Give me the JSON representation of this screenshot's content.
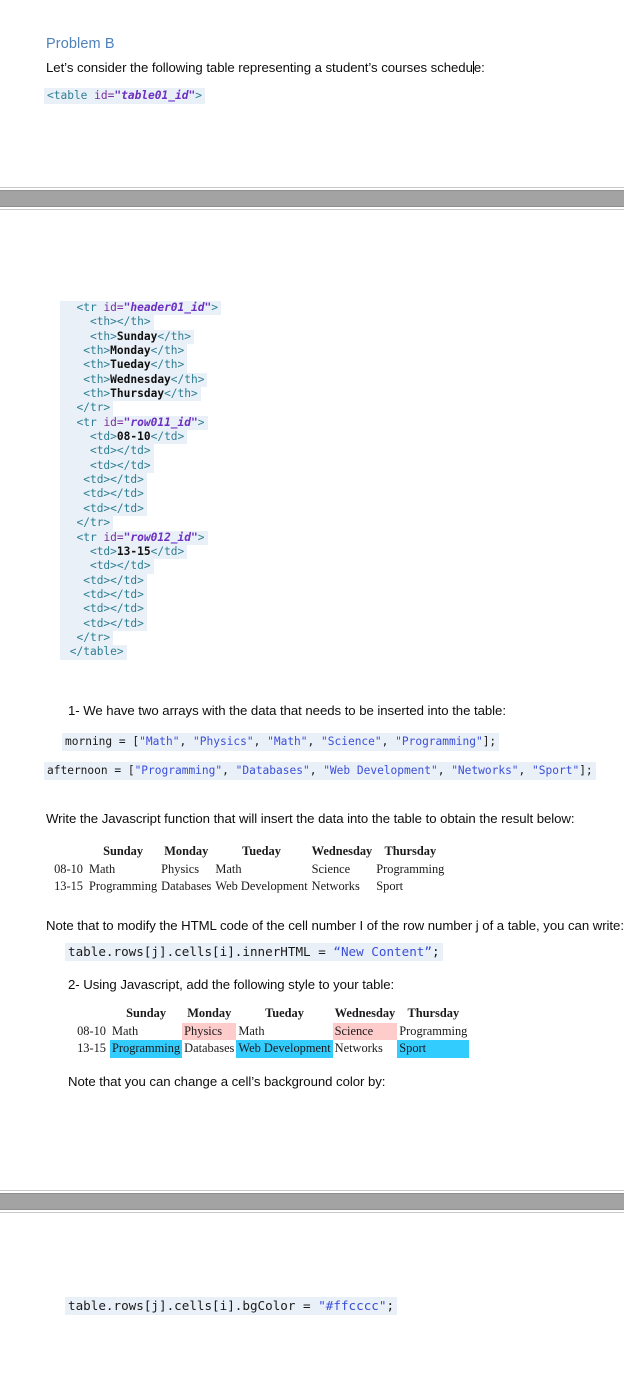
{
  "document": {
    "heading": "Problem B",
    "intro": "Let’s consider the following table representing a student’s courses schedule:",
    "code_open_table": {
      "tag_open": "<table ",
      "attr": "id=",
      "value": "\"table01_id\"",
      "tag_close": ">"
    },
    "code_block": {
      "lines": [
        {
          "indent": "  ",
          "parts": [
            {
              "t": "tag",
              "s": "<tr "
            },
            {
              "t": "attr",
              "s": "id="
            },
            {
              "t": "val",
              "s": "\"header01_id\""
            },
            {
              "t": "tag",
              "s": ">"
            }
          ]
        },
        {
          "indent": "    ",
          "parts": [
            {
              "t": "tag",
              "s": "<th></th>"
            }
          ]
        },
        {
          "indent": "    ",
          "parts": [
            {
              "t": "tag",
              "s": "<th>"
            },
            {
              "t": "txt",
              "s": "Sunday"
            },
            {
              "t": "tag",
              "s": "</th>"
            }
          ]
        },
        {
          "indent": "   ",
          "parts": [
            {
              "t": "tag",
              "s": "<th>"
            },
            {
              "t": "txt",
              "s": "Monday"
            },
            {
              "t": "tag",
              "s": "</th>"
            }
          ]
        },
        {
          "indent": "   ",
          "parts": [
            {
              "t": "tag",
              "s": "<th>"
            },
            {
              "t": "txt",
              "s": "Tueday"
            },
            {
              "t": "tag",
              "s": "</th>"
            }
          ]
        },
        {
          "indent": "   ",
          "parts": [
            {
              "t": "tag",
              "s": "<th>"
            },
            {
              "t": "txt",
              "s": "Wednesday"
            },
            {
              "t": "tag",
              "s": "</th>"
            }
          ]
        },
        {
          "indent": "   ",
          "parts": [
            {
              "t": "tag",
              "s": "<th>"
            },
            {
              "t": "txt",
              "s": "Thursday"
            },
            {
              "t": "tag",
              "s": "</th>"
            }
          ]
        },
        {
          "indent": "  ",
          "parts": [
            {
              "t": "tag",
              "s": "</tr>"
            }
          ]
        },
        {
          "indent": "  ",
          "parts": [
            {
              "t": "tag",
              "s": "<tr "
            },
            {
              "t": "attr",
              "s": "id="
            },
            {
              "t": "val",
              "s": "\"row011_id\""
            },
            {
              "t": "tag",
              "s": ">"
            }
          ]
        },
        {
          "indent": "    ",
          "parts": [
            {
              "t": "tag",
              "s": "<td>"
            },
            {
              "t": "txt",
              "s": "08-10"
            },
            {
              "t": "tag",
              "s": "</td>"
            }
          ]
        },
        {
          "indent": "    ",
          "parts": [
            {
              "t": "tag",
              "s": "<td></td>"
            }
          ]
        },
        {
          "indent": "    ",
          "parts": [
            {
              "t": "tag",
              "s": "<td></td>"
            }
          ]
        },
        {
          "indent": "   ",
          "parts": [
            {
              "t": "tag",
              "s": "<td></td>"
            }
          ]
        },
        {
          "indent": "   ",
          "parts": [
            {
              "t": "tag",
              "s": "<td></td>"
            }
          ]
        },
        {
          "indent": "   ",
          "parts": [
            {
              "t": "tag",
              "s": "<td></td>"
            }
          ]
        },
        {
          "indent": "  ",
          "parts": [
            {
              "t": "tag",
              "s": "</tr>"
            }
          ]
        },
        {
          "indent": "  ",
          "parts": [
            {
              "t": "tag",
              "s": "<tr "
            },
            {
              "t": "attr",
              "s": "id="
            },
            {
              "t": "val",
              "s": "\"row012_id\""
            },
            {
              "t": "tag",
              "s": ">"
            }
          ]
        },
        {
          "indent": "    ",
          "parts": [
            {
              "t": "tag",
              "s": "<td>"
            },
            {
              "t": "txt",
              "s": "13-15"
            },
            {
              "t": "tag",
              "s": "</td>"
            }
          ]
        },
        {
          "indent": "    ",
          "parts": [
            {
              "t": "tag",
              "s": "<td></td>"
            }
          ]
        },
        {
          "indent": "   ",
          "parts": [
            {
              "t": "tag",
              "s": "<td></td>"
            }
          ]
        },
        {
          "indent": "   ",
          "parts": [
            {
              "t": "tag",
              "s": "<td></td>"
            }
          ]
        },
        {
          "indent": "   ",
          "parts": [
            {
              "t": "tag",
              "s": "<td></td>"
            }
          ]
        },
        {
          "indent": "   ",
          "parts": [
            {
              "t": "tag",
              "s": "<td></td>"
            }
          ]
        },
        {
          "indent": "  ",
          "parts": [
            {
              "t": "tag",
              "s": "</tr>"
            }
          ]
        },
        {
          "indent": " ",
          "parts": [
            {
              "t": "tag",
              "s": "</table>"
            }
          ]
        }
      ]
    },
    "item_1": "1-   We have two arrays with the data that needs to be inserted into the table:",
    "array_morning": {
      "name": "morning = [",
      "items": [
        "\"Math\"",
        "\"Physics\"",
        "\"Math\"",
        "\"Science\"",
        "\"Programming\""
      ],
      "end": "];"
    },
    "array_afternoon": {
      "name": "afternoon = [",
      "items": [
        "\"Programming\"",
        "\"Databases\"",
        "\"Web Development\"",
        "\"Networks\"",
        "\"Sport\""
      ],
      "end": "];"
    },
    "write_js": "Write the Javascript function that will insert the data into the table to obtain the result below:",
    "note_modify": "Note that to modify the HTML code of the cell number I of the row number j of a table, you can write:",
    "code_innerhtml": {
      "prefix": "table.rows[j].cells[i].innerHTML = ",
      "string": "“New Content”",
      "suffix": ";"
    },
    "item_2": "2-   Using Javascript, add the following style to your table:",
    "note_bgcolor": "Note that you can change a cell’s background color by:",
    "code_bgcolor": {
      "prefix": "table.rows[j].cells[i].bgColor = ",
      "string": "\"#ffcccc\"",
      "suffix": ";"
    }
  },
  "result_table_plain": {
    "headers": [
      "",
      "Sunday",
      "Monday",
      "Tueday",
      "Wednesday",
      "Thursday"
    ],
    "rows": [
      {
        "label": "08-10",
        "cells": [
          "Math",
          "Physics",
          "Math",
          "Science",
          "Programming"
        ]
      },
      {
        "label": "13-15",
        "cells": [
          "Programming",
          "Databases",
          "Web Development",
          "Networks",
          "Sport"
        ]
      }
    ]
  },
  "result_table_styled": {
    "headers": [
      "",
      "Sunday",
      "Monday",
      "Tueday",
      "Wednesday",
      "Thursday"
    ],
    "rows": [
      {
        "label": "08-10",
        "cells": [
          {
            "text": "Math",
            "bg": ""
          },
          {
            "text": "Physics",
            "bg": "#ffcccc"
          },
          {
            "text": "Math",
            "bg": ""
          },
          {
            "text": "Science",
            "bg": "#ffcccc"
          },
          {
            "text": "Programming",
            "bg": ""
          }
        ]
      },
      {
        "label": "13-15",
        "cells": [
          {
            "text": "Programming",
            "bg": "#33ccff"
          },
          {
            "text": "Databases",
            "bg": ""
          },
          {
            "text": "Web Development",
            "bg": "#33ccff"
          },
          {
            "text": "Networks",
            "bg": ""
          },
          {
            "text": "Sport",
            "bg": "#33ccff"
          }
        ]
      }
    ]
  },
  "colors": {
    "heading": "#4f81bd",
    "pink_cell": "#ffcccc",
    "cyan_cell": "#33ccff",
    "separator_bar": "#a3a3a3",
    "code_highlight": "#eaf0f8"
  }
}
